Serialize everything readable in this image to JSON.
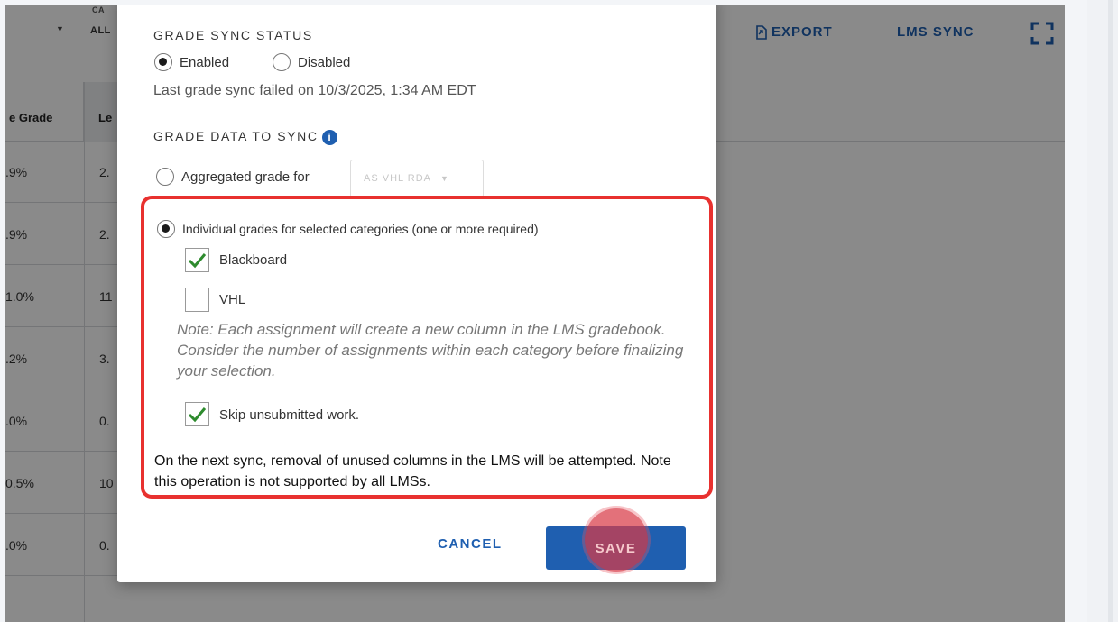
{
  "toolbar": {
    "category_label_top": "CA",
    "category_value": "ALL",
    "export_label": "EXPORT",
    "lms_sync_label": "LMS SYNC"
  },
  "grid": {
    "header_col1": "e Grade",
    "header_col2": "Le",
    "rows": [
      {
        "c1": ".9%",
        "c2": "2."
      },
      {
        "c1": ".9%",
        "c2": "2."
      },
      {
        "c1": "1.0%",
        "c2": "11"
      },
      {
        "c1": ".2%",
        "c2": "3."
      },
      {
        "c1": ".0%",
        "c2": "0."
      },
      {
        "c1": "0.5%",
        "c2": "10"
      },
      {
        "c1": ".0%",
        "c2": "0."
      }
    ]
  },
  "dialog": {
    "sync_status_title": "GRADE SYNC STATUS",
    "status_options": [
      {
        "label": "Enabled",
        "selected": true
      },
      {
        "label": "Disabled",
        "selected": false
      }
    ],
    "last_sync_message": "Last grade sync failed on 10/3/2025, 1:34 AM EDT",
    "grade_data_title": "GRADE DATA TO SYNC",
    "aggregated_option": {
      "label": "Aggregated grade for",
      "selected": false,
      "select_value": "AS VHL RDA"
    },
    "individual_option": {
      "label": "Individual grades for selected categories (one or more required)",
      "selected": true
    },
    "categories": [
      {
        "label": "Blackboard",
        "checked": true
      },
      {
        "label": "VHL",
        "checked": false
      }
    ],
    "note": "Note: Each assignment will create a new column in the LMS gradebook. Consider the number of assignments within each category before finalizing your selection.",
    "skip_unsubmitted": {
      "label": "Skip unsubmitted work.",
      "checked": true
    },
    "footnote": "On the next sync, removal of unused columns in the LMS will be attempted. Note this operation is not supported by all LMSs.",
    "cancel_label": "CANCEL",
    "save_label": "SAVE"
  },
  "colors": {
    "accent": "#1f5fb0",
    "highlight": "#e8312f",
    "check": "#2e8b2e",
    "click_indicator": "#d83a46"
  }
}
